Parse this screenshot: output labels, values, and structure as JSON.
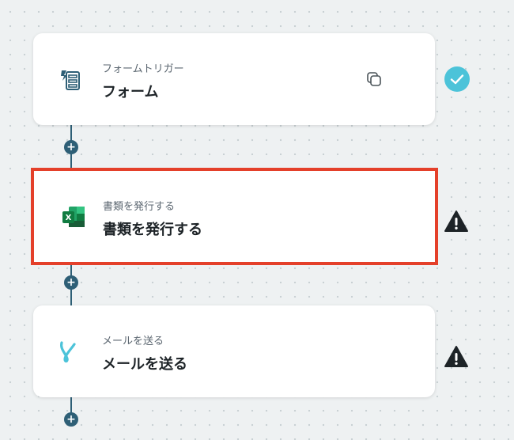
{
  "steps": [
    {
      "subtitle": "フォームトリガー",
      "title": "フォーム",
      "icon": "form-icon",
      "status": "check-icon"
    },
    {
      "subtitle": "書類を発行する",
      "title": "書類を発行する",
      "icon": "excel-icon",
      "status": "warning-icon"
    },
    {
      "subtitle": "メールを送る",
      "title": "メールを送る",
      "icon": "mail-icon",
      "status": "warning-icon"
    }
  ],
  "add_button_label": "+",
  "colors": {
    "connector": "#2e5f76",
    "selected_border": "#e4402a",
    "check": "#4cc3d9",
    "warning": "#1d2327"
  }
}
